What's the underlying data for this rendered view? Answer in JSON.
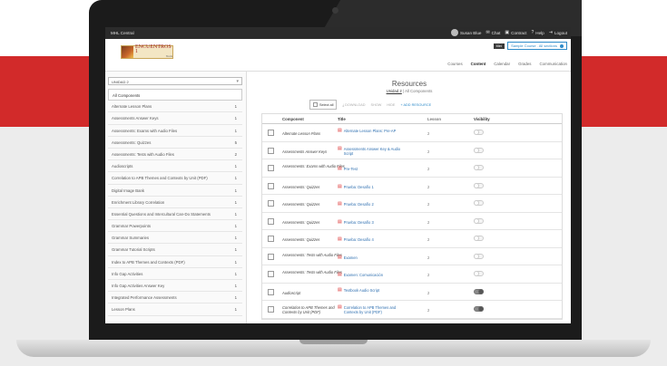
{
  "topbar": {
    "app_name": "MHL Central",
    "user": "Susan Blue",
    "chat": "Chat",
    "contract": "Contract",
    "help": "Help",
    "logout": "Logout"
  },
  "header": {
    "logo_text": "ENCUENTROS 1",
    "logo_sub": "Vocés",
    "mini_button": "Mini",
    "course_selector": "Sample Course . All sections",
    "nav": [
      "Courses",
      "Content",
      "Calendar",
      "Grades",
      "Communication"
    ],
    "active_nav": "Content"
  },
  "sidebar": {
    "unit_select": "UNIDAD 2",
    "items": [
      {
        "label": "All Components",
        "count": ""
      },
      {
        "label": "Alternate Lesson Plans",
        "count": "1"
      },
      {
        "label": "Assessments Answer Keys",
        "count": "1"
      },
      {
        "label": "Assessments: Exams with Audio Files",
        "count": "1"
      },
      {
        "label": "Assessments: Quizzes",
        "count": "5"
      },
      {
        "label": "Assessments: Tests with Audio Files",
        "count": "2"
      },
      {
        "label": "Audioscripts",
        "count": "1"
      },
      {
        "label": "Correlation to APB Themes and Contexts by Unit (PDF)",
        "count": "1"
      },
      {
        "label": "Digital Image Bank",
        "count": "1"
      },
      {
        "label": "Enrichment Library Correlation",
        "count": "1"
      },
      {
        "label": "Essential Questions and Intercultural Can-Do Statements",
        "count": "1"
      },
      {
        "label": "Grammar Powerpoints",
        "count": "1"
      },
      {
        "label": "Grammar Summaries",
        "count": "1"
      },
      {
        "label": "Grammar Tutorial Scripts",
        "count": "1"
      },
      {
        "label": "Index to APB Themes and Contexts (PDF)",
        "count": "1"
      },
      {
        "label": "Info Gap Activities",
        "count": "1"
      },
      {
        "label": "Info Gap Activities Answer Key",
        "count": "1"
      },
      {
        "label": "Integrated Performance Assessments",
        "count": "1"
      },
      {
        "label": "Lesson Plans",
        "count": "1"
      }
    ]
  },
  "main": {
    "title": "Resources",
    "unit_link": "Unidad 2",
    "breadcrumb_rest": "| All Components",
    "select_all": "Select all",
    "download": "DOWNLOAD",
    "show": "SHOW",
    "hide": "HIDE",
    "add_resource": "ADD RESOURCE",
    "columns": [
      "Component",
      "Title",
      "Lesson",
      "Visibility"
    ],
    "rows": [
      {
        "component": "Alternate Lesson Plans",
        "title": "Alternate Lesson Plans: Pre-AP",
        "lesson": "2",
        "visible": false
      },
      {
        "component": "Assessments Answer Keys",
        "title": "Assessments Answer Key & Audio Script",
        "lesson": "2",
        "visible": false
      },
      {
        "component": "Assessments: Exams with Audio Files",
        "title": "Pre-Test",
        "lesson": "2",
        "visible": false
      },
      {
        "component": "Assessments: Quizzes",
        "title": "Prueba: Desafío 1",
        "lesson": "2",
        "visible": false
      },
      {
        "component": "Assessments: Quizzes",
        "title": "Prueba: Desafío 2",
        "lesson": "2",
        "visible": false
      },
      {
        "component": "Assessments: Quizzes",
        "title": "Prueba: Desafío 3",
        "lesson": "2",
        "visible": false
      },
      {
        "component": "Assessments: Quizzes",
        "title": "Prueba: Desafío 4",
        "lesson": "2",
        "visible": false
      },
      {
        "component": "Assessments: Tests with Audio Files",
        "title": "Examen",
        "lesson": "2",
        "visible": false
      },
      {
        "component": "Assessments: Tests with Audio Files",
        "title": "Examen: Comunicación",
        "lesson": "2",
        "visible": false
      },
      {
        "component": "Audioscript",
        "title": "Textbook Audio Script",
        "lesson": "2",
        "visible": true
      },
      {
        "component": "Correlation to APB Themes and Contexts by Unit (PDF)",
        "title": "Correlation to APB Themes and Contexts by Unit (PDF)",
        "lesson": "2",
        "visible": true
      }
    ]
  },
  "colors": {
    "brand_red": "#d22a2a",
    "accent_blue": "#2e8bc9"
  }
}
